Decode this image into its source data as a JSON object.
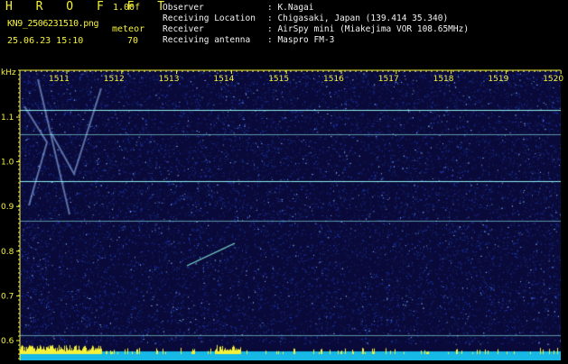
{
  "header": {
    "title": "H R O F F T",
    "version": "1.00f",
    "filename": "KN9_2506231510.png",
    "meteor_label": "meteor",
    "datetime": "25.06.23 15:10",
    "meteor_count": "70"
  },
  "info": {
    "observer_label": "Observer",
    "observer_value": ": K.Nagai",
    "location_label": "Receiving Location",
    "location_value": ": Chigasaki, Japan (139.414 35.340)",
    "receiver_label": "Receiver",
    "receiver_value": ": AirSpy mini (Miakejima VOR 108.65MHz)",
    "antenna_label": "Receiving antenna",
    "antenna_value": ": Maspro FM-3"
  },
  "plot": {
    "y_unit": "kHz",
    "x_ticks": [
      "1511",
      "1512",
      "1513",
      "1514",
      "1515",
      "1516",
      "1517",
      "1518",
      "1519",
      "1520"
    ],
    "y_ticks": [
      "1.1",
      "1.0",
      "0.9",
      "0.8",
      "0.7",
      "0.6"
    ],
    "colors": {
      "background": "#0a0a3a",
      "noise": "#1f3ec8",
      "carrier": "#8ff0e8",
      "strip": "#16b8e6",
      "peaks": "#f6f23a",
      "axis": "#f6f23a"
    }
  }
}
